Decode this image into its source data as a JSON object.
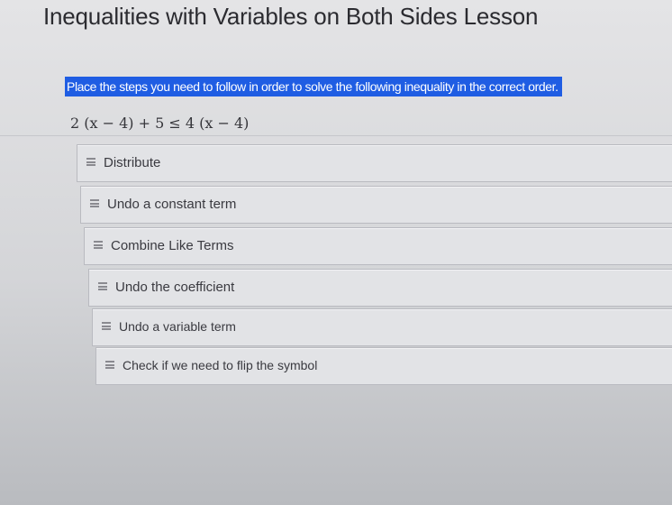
{
  "lesson": {
    "title": "Inequalities with Variables on Both Sides Lesson"
  },
  "question": {
    "instruction": "Place the steps you need to follow in order to solve the following inequality in the correct order.",
    "inequality": "2 (x − 4) + 5 ≤ 4 (x − 4)"
  },
  "steps": [
    {
      "label": "Distribute",
      "icon": "drag-handle-icon"
    },
    {
      "label": "Undo a constant term",
      "icon": "drag-handle-icon"
    },
    {
      "label": "Combine Like Terms",
      "icon": "drag-handle-icon"
    },
    {
      "label": "Undo the coefficient",
      "icon": "drag-handle-icon"
    },
    {
      "label": "Undo a variable term",
      "icon": "drag-handle-icon"
    },
    {
      "label": "Check if we need to flip the symbol",
      "icon": "drag-handle-icon"
    }
  ],
  "colors": {
    "instruction_highlight": "#1f5de3",
    "background": "#dcdcdf"
  }
}
